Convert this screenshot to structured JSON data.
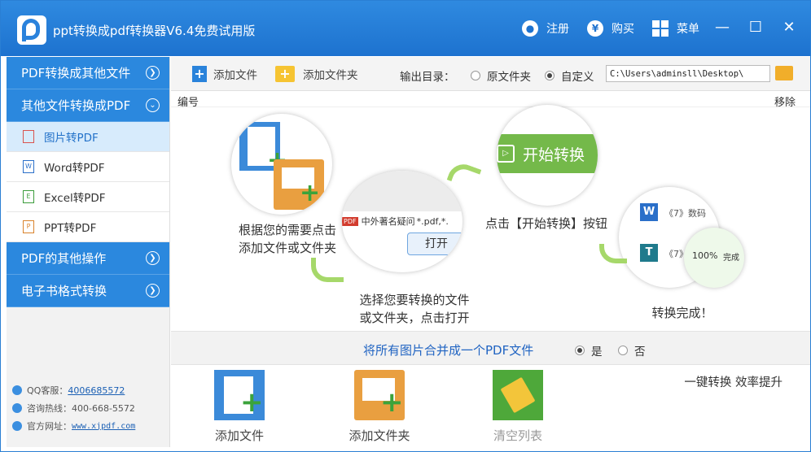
{
  "app": {
    "title": "ppt转换成pdf转换器V6.4免费试用版",
    "register": "注册",
    "buy": "购买",
    "menu": "菜单",
    "buy_symbol": "¥"
  },
  "sidebar": {
    "cat1": "PDF转换成其他文件",
    "cat2": "其他文件转换成PDF",
    "items": [
      {
        "label": "图片转PDF"
      },
      {
        "label": "Word转PDF"
      },
      {
        "label": "Excel转PDF"
      },
      {
        "label": "PPT转PDF"
      }
    ],
    "cat3": "PDF的其他操作",
    "cat4": "电子书格式转换",
    "contact": {
      "qq_label": "QQ客服：",
      "qq": "4006685572",
      "hotline_label": "咨询热线：",
      "hotline": "400-668-5572",
      "site_label": "官方网址：",
      "site": "www.xjpdf.com"
    }
  },
  "toolbar": {
    "add_file": "添加文件",
    "add_folder": "添加文件夹",
    "output_label": "输出目录：",
    "opt_src": "原文件夹",
    "opt_custom": "自定义",
    "path": "C:\\Users\\adminsll\\Desktop\\"
  },
  "list": {
    "col_no": "编号",
    "col_remove": "移除"
  },
  "guide": {
    "step1": "根据您的需要点击\n添加文件或文件夹",
    "step2": "选择您要转换的文件\n或文件夹，点击打开",
    "step3": "点击【开始转换】按钮",
    "step4": "转换完成！",
    "pdf_badge": "PDF",
    "demo_file": "中外著名疑问",
    "demo_ext": "*.pdf,*.",
    "open_btn": "打开",
    "start_btn": "开始转换",
    "doc1": "《7》数码",
    "doc2": "《7》",
    "progress": "100%",
    "done": "完成",
    "w_letter": "W",
    "t_letter": "T"
  },
  "merge": {
    "text": "将所有图片合并成一个PDF文件",
    "yes": "是",
    "no": "否"
  },
  "bottom": {
    "add_file": "添加文件",
    "add_folder": "添加文件夹",
    "clear": "清空列表",
    "slogan": "一键转换  效率提升"
  }
}
